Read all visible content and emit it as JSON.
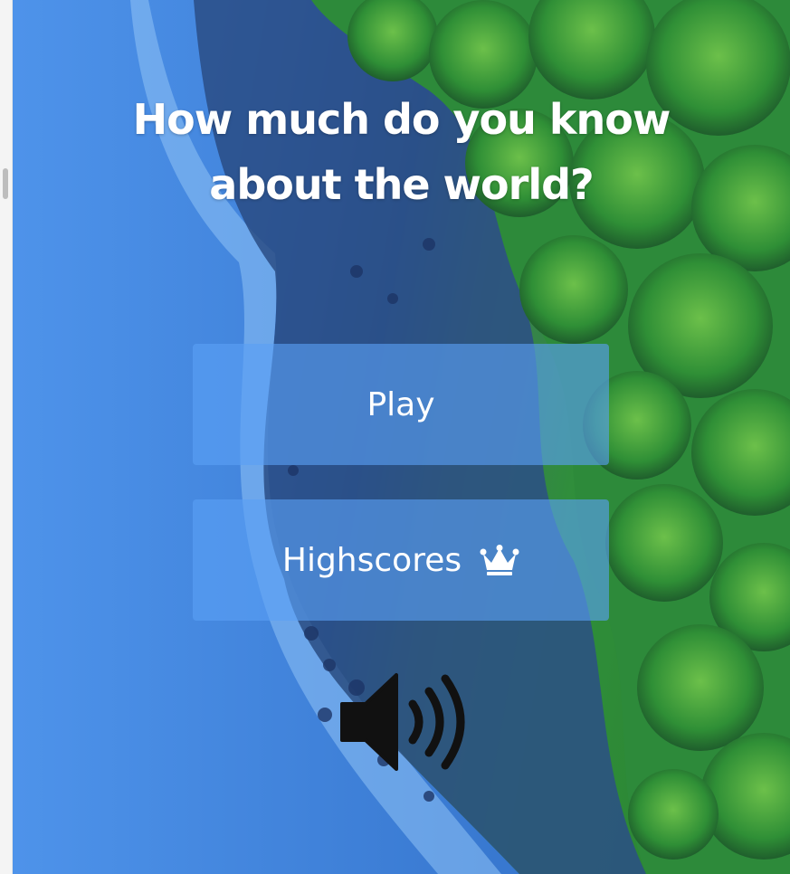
{
  "page": {
    "title_line1": "How much do you know",
    "title_line2": "about the world?"
  },
  "menu": {
    "play_label": "Play",
    "highscores_label": "Highscores",
    "highscores_icon": "crown-icon"
  },
  "controls": {
    "sound_icon": "speaker-volume-icon"
  },
  "colors": {
    "button_fill": "#5aa0f5",
    "text": "#ffffff",
    "icon_dark": "#111111"
  }
}
